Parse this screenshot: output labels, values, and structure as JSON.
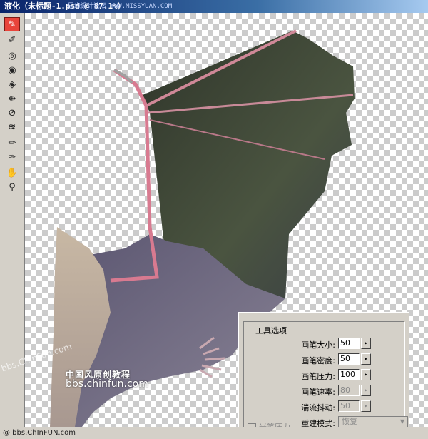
{
  "window": {
    "title": "液化（未标题-1.psd @ 87.1%）",
    "watermark": "思缘设计论坛 WWW.MISSYUAN.COM"
  },
  "tools": [
    {
      "name": "forward-warp-icon",
      "active": true
    },
    {
      "name": "reconstruct-icon",
      "active": false
    },
    {
      "name": "twirl-icon",
      "active": false
    },
    {
      "name": "pucker-icon",
      "active": false
    },
    {
      "name": "bloat-icon",
      "active": false
    },
    {
      "name": "push-left-icon",
      "active": false
    },
    {
      "name": "mirror-icon",
      "active": false
    },
    {
      "name": "turbulence-icon",
      "active": false
    },
    {
      "name": "freeze-mask-icon",
      "active": false
    },
    {
      "name": "thaw-mask-icon",
      "active": false
    },
    {
      "name": "hand-icon",
      "active": false
    },
    {
      "name": "zoom-icon",
      "active": false
    }
  ],
  "tool_options": {
    "title": "工具选项",
    "brush_size": {
      "label": "画笔大小:",
      "value": "50"
    },
    "brush_density": {
      "label": "画笔密度:",
      "value": "50"
    },
    "brush_pressure": {
      "label": "画笔压力:",
      "value": "100"
    },
    "brush_rate": {
      "label": "画笔速率:",
      "value": "80"
    },
    "turbulent_jitter": {
      "label": "湍流抖动:",
      "value": "50"
    },
    "reconstruct_mode": {
      "label": "重建模式:",
      "value": "恢复"
    },
    "stylus_pressure": {
      "label": "光笔压力"
    }
  },
  "watermarks": {
    "cn": "中国风原创教程",
    "url": "bbs.chinfun.com",
    "left": "bbs.ChinFun.com"
  },
  "statusbar": {
    "text": "@ bbs.ChInFUN.com"
  },
  "colors": {
    "active_tool": "#e8443a",
    "wing_membrane": "#3e4636",
    "fur": "#6a6478",
    "bone": "#d87a90"
  }
}
